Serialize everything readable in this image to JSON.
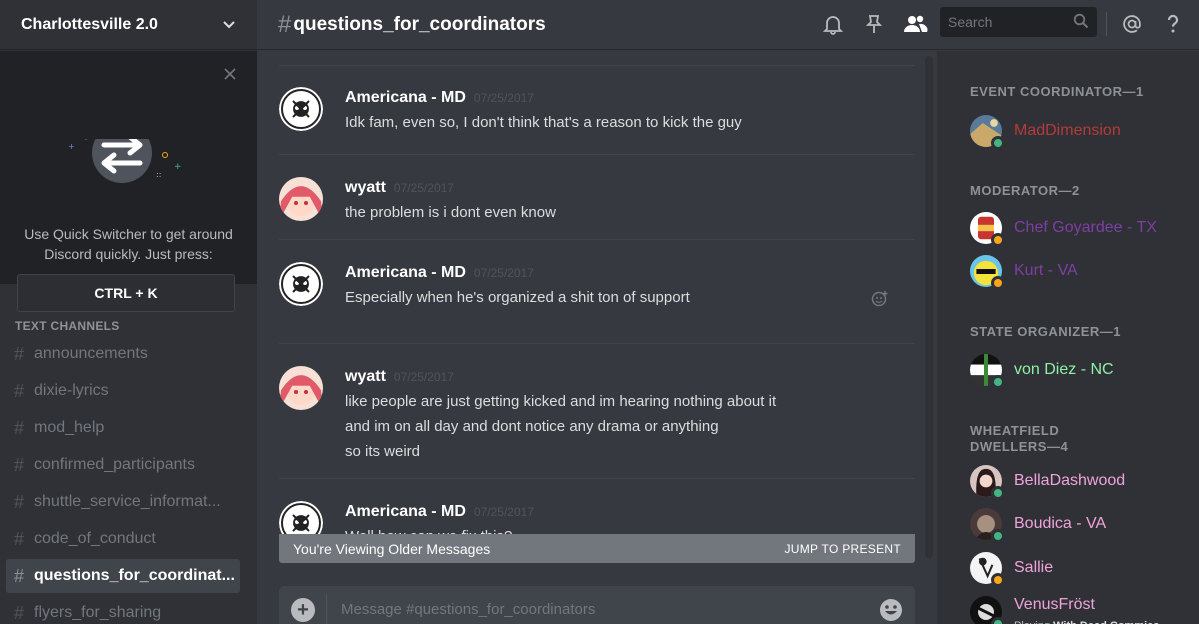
{
  "server": {
    "name": "Charlottesville 2.0"
  },
  "quick_switcher": {
    "text_line1": "Use Quick Switcher to get around",
    "text_line2": "Discord quickly. Just press:",
    "shortcut": "CTRL + K"
  },
  "channels": {
    "header": "TEXT CHANNELS",
    "items": [
      {
        "name": "announcements"
      },
      {
        "name": "dixie-lyrics"
      },
      {
        "name": "mod_help"
      },
      {
        "name": "confirmed_participants"
      },
      {
        "name": "shuttle_service_informat..."
      },
      {
        "name": "code_of_conduct"
      },
      {
        "name": "questions_for_coordinat...",
        "selected": true
      },
      {
        "name": "flyers_for_sharing"
      }
    ]
  },
  "topbar": {
    "hash": "#",
    "channel_name": "questions_for_coordinators",
    "search_placeholder": "Search"
  },
  "messages": [
    {
      "author": "Americana - MD",
      "time": "07/25/2017",
      "avatar": "skull-badge",
      "lines": [
        "Idk fam, even so, I don't think that's a reason to kick the guy"
      ]
    },
    {
      "author": "wyatt",
      "time": "07/25/2017",
      "avatar": "anime-girl",
      "lines": [
        "the problem is i dont even know"
      ]
    },
    {
      "author": "Americana - MD",
      "time": "07/25/2017",
      "avatar": "skull-badge",
      "lines": [
        "Especially when he's organized a shit ton of support"
      ]
    },
    {
      "author": "wyatt",
      "time": "07/25/2017",
      "avatar": "anime-girl",
      "lines": [
        "like people are just getting kicked and im hearing nothing about it",
        "and im on all day and dont notice any drama or anything",
        "so its weird"
      ]
    },
    {
      "author": "Americana - MD",
      "time": "07/25/2017",
      "avatar": "skull-badge",
      "lines": [
        "Well how can we fix this?"
      ]
    }
  ],
  "older_bar": {
    "text": "You're Viewing Older Messages",
    "jump": "JUMP TO PRESENT"
  },
  "composer": {
    "placeholder": "Message #questions_for_coordinators"
  },
  "members": {
    "roles": [
      {
        "title": "EVENT COORDINATOR—1",
        "members": [
          {
            "name": "MadDimension",
            "color": "#b53a3a",
            "status": "online",
            "avatar": "landscape"
          }
        ]
      },
      {
        "title": "MODERATOR—2",
        "members": [
          {
            "name": "Chef Goyardee - TX",
            "color": "#7d3fa3",
            "status": "idle",
            "avatar": "can"
          },
          {
            "name": "Kurt - VA",
            "color": "#7d3fa3",
            "status": "idle",
            "avatar": "yellow-face"
          }
        ]
      },
      {
        "title": "STATE ORGANIZER—1",
        "members": [
          {
            "name": "von Diez - NC",
            "color": "#8ff0a4",
            "status": "online",
            "avatar": "flag"
          }
        ]
      },
      {
        "title": "WHEATFIELD DWELLERS—4",
        "members": [
          {
            "name": "BellaDashwood",
            "color": "#f0a3d9",
            "status": "online",
            "avatar": "portrait-dark"
          },
          {
            "name": "Boudica - VA",
            "color": "#f0a3d9",
            "status": "online",
            "avatar": "portrait-bw"
          },
          {
            "name": "Sallie",
            "color": "#f0a3d9",
            "status": "idle",
            "avatar": "portrait-sketch"
          },
          {
            "name": "VenusFröst",
            "color": "#f0a3d9",
            "status": "online",
            "avatar": "portrait-mono",
            "activity_prefix": "Playing",
            "activity": "With Dead Commies"
          }
        ]
      }
    ]
  },
  "colors": {
    "online": "#43b581",
    "idle": "#faa61a",
    "accent": "#7289da"
  }
}
